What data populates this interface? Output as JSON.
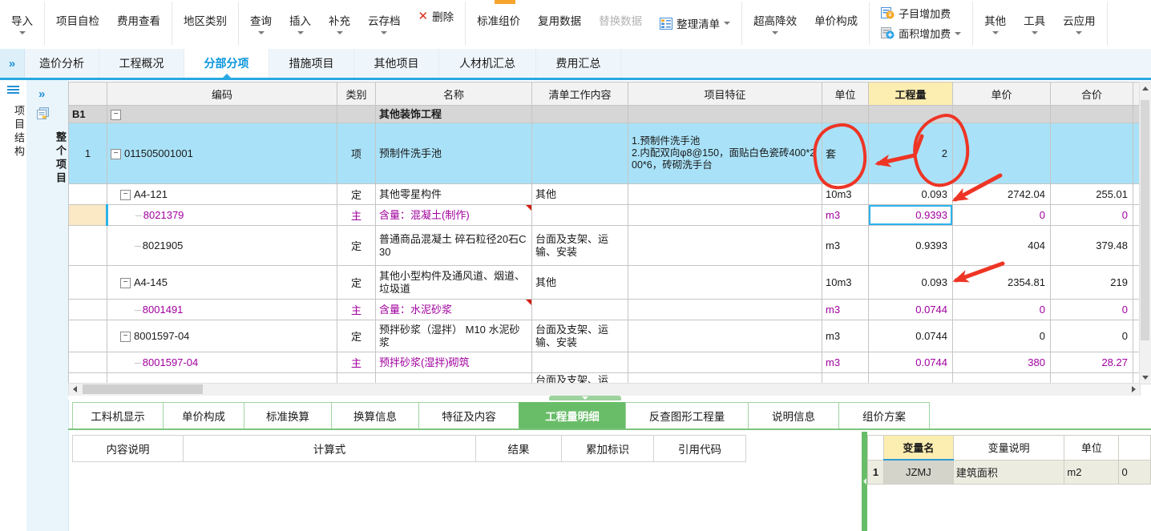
{
  "toolbar": {
    "items": [
      {
        "label": "导入"
      },
      {
        "label": "项目自检"
      },
      {
        "label": "费用查看"
      },
      {
        "label": "地区类别"
      },
      {
        "label": "查询"
      },
      {
        "label": "插入"
      },
      {
        "label": "补充"
      },
      {
        "label": "云存档"
      },
      {
        "label": "删除"
      },
      {
        "label": "标准组价"
      },
      {
        "label": "复用数据"
      },
      {
        "label": "替换数据"
      },
      {
        "label": "整理清单"
      },
      {
        "label": "超高降效"
      },
      {
        "label": "单价构成"
      },
      {
        "label": "子目增加费"
      },
      {
        "label": "面积增加费"
      },
      {
        "label": "其他"
      },
      {
        "label": "工具"
      },
      {
        "label": "云应用"
      }
    ]
  },
  "tabs": {
    "items": [
      {
        "label": "造价分析"
      },
      {
        "label": "工程概况"
      },
      {
        "label": "分部分项"
      },
      {
        "label": "措施项目"
      },
      {
        "label": "其他项目"
      },
      {
        "label": "人材机汇总"
      },
      {
        "label": "费用汇总"
      }
    ],
    "selected": "分部分项"
  },
  "sidebar": {
    "panel_title": "项目结构",
    "tree_item": "整个项目"
  },
  "grid": {
    "selected_column": "工程量",
    "columns": [
      "编码",
      "类别",
      "名称",
      "清单工作内容",
      "项目特征",
      "单位",
      "工程量",
      "单价",
      "合价"
    ],
    "rows": [
      {
        "marker": "B1",
        "name": "其他装饰工程"
      },
      {
        "marker": "1",
        "code": "011505001001",
        "category": "项",
        "name": "预制件洗手池",
        "feature": "1.预制件洗手池\n2.内配双向φ8@150，面贴白色瓷砖400*200*6，砖砌洗手台",
        "unit": "套",
        "quantity": "2"
      },
      {
        "code": "A4-121",
        "category": "定",
        "name": "其他零星构件",
        "work": "其他",
        "unit": "10m3",
        "quantity": "0.093",
        "price": "2742.04",
        "total": "255.01"
      },
      {
        "code": "8021379",
        "category": "主",
        "name": "含量：混凝土(制作)",
        "unit": "m3",
        "quantity": "0.9393",
        "price": "0",
        "total": "0"
      },
      {
        "code": "8021905",
        "category": "定",
        "name": "普通商品混凝土 碎石粒径20石C30",
        "work": "台面及支架、运输、安装",
        "unit": "m3",
        "quantity": "0.9393",
        "price": "404",
        "total": "379.48"
      },
      {
        "code": "A4-145",
        "category": "定",
        "name": "其他小型构件及通风道、烟道、垃圾道",
        "work": "其他",
        "unit": "10m3",
        "quantity": "0.093",
        "price": "2354.81",
        "total": "219"
      },
      {
        "code": "8001491",
        "category": "主",
        "name": "含量：水泥砂浆",
        "unit": "m3",
        "quantity": "0.0744",
        "price": "0",
        "total": "0"
      },
      {
        "code": "8001597-04",
        "category": "定",
        "name": "预拌砂浆（湿拌） M10 水泥砂浆",
        "work": "台面及支架、运输、安装",
        "unit": "m3",
        "quantity": "0.0744",
        "price": "0",
        "total": "0"
      },
      {
        "code": "8001597-04",
        "category": "主",
        "name": "预拌砂浆(湿拌)砌筑",
        "unit": "m3",
        "quantity": "0.0744",
        "price": "380",
        "total": "28.27"
      },
      {
        "work": "台面及支架、运输、"
      }
    ]
  },
  "bottom_tabs": {
    "items": [
      {
        "label": "工料机显示"
      },
      {
        "label": "单价构成"
      },
      {
        "label": "标准换算"
      },
      {
        "label": "换算信息"
      },
      {
        "label": "特征及内容"
      },
      {
        "label": "工程量明细"
      },
      {
        "label": "反查图形工程量"
      },
      {
        "label": "说明信息"
      },
      {
        "label": "组价方案"
      }
    ],
    "selected": "工程量明细"
  },
  "detail_table": {
    "columns": [
      "内容说明",
      "计算式",
      "结果",
      "累加标识",
      "引用代码"
    ]
  },
  "var_table": {
    "columns": [
      "变量名",
      "变量说明",
      "单位"
    ],
    "rows": [
      {
        "num": "1",
        "name": "JZMJ",
        "desc": "建筑面积",
        "unit": "m2",
        "value": "0"
      }
    ]
  },
  "colors": {
    "selected_row": "#a9e2f8",
    "tab_accent": "#29a8e1",
    "green_accent": "#69bd69",
    "annotation_red": "#ee3525",
    "detail_text_purple": "#a0009e",
    "quantity_header_bg": "#fcedb0"
  }
}
